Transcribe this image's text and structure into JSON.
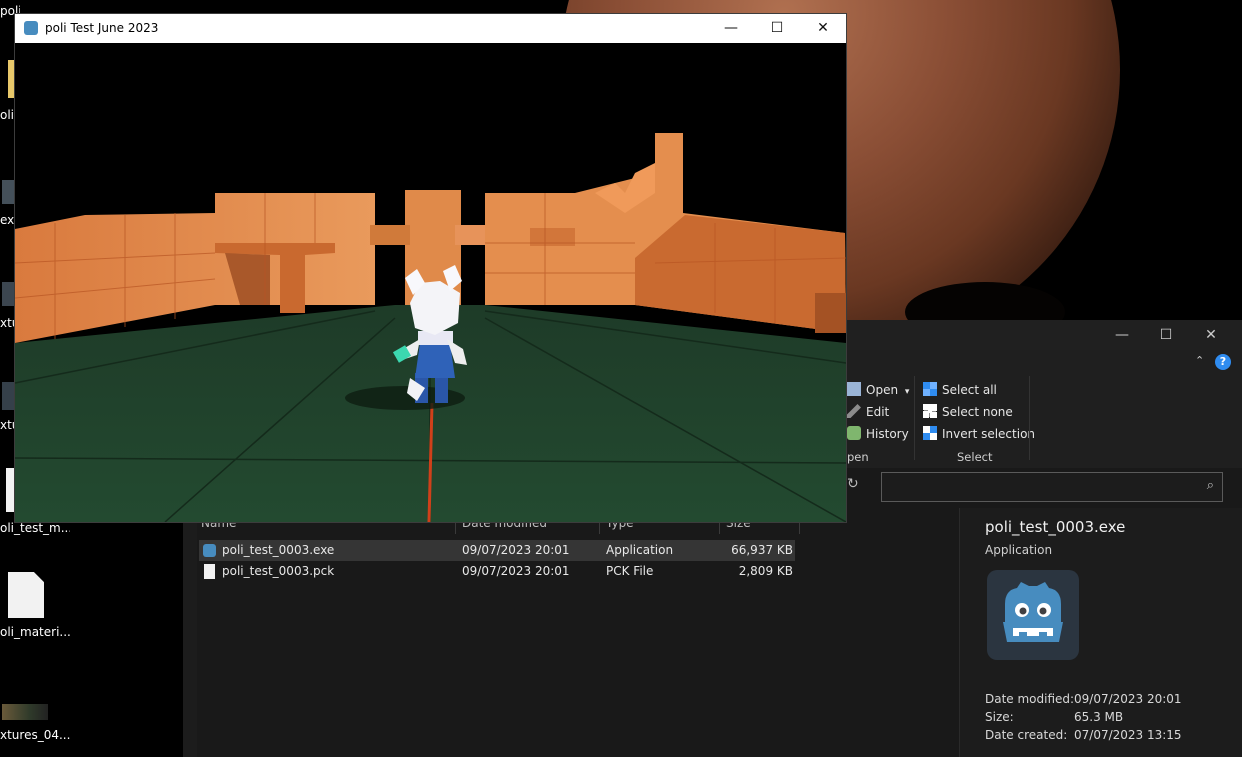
{
  "desktop": {
    "icons": [
      {
        "label": "poli_...",
        "icon": "folder-icon"
      },
      {
        "label": "oli",
        "icon": "folder-icon"
      },
      {
        "label": "ext",
        "icon": "image-icon"
      },
      {
        "label": "xtu",
        "icon": "image-icon"
      },
      {
        "label": "xtu",
        "icon": "image-icon"
      },
      {
        "label": "oli_test_m...",
        "icon": "file-icon"
      },
      {
        "label": "oli_materi...",
        "icon": "file-icon"
      },
      {
        "label": "xtures_04....",
        "icon": "image-icon"
      }
    ]
  },
  "game_window": {
    "title": "poli Test June 2023",
    "minimize": "—",
    "maximize": "☐",
    "close": "✕"
  },
  "explorer": {
    "minimize": "—",
    "maximize": "☐",
    "close": "✕",
    "ribbon": {
      "open_group": {
        "items": [
          {
            "label": "Open",
            "icon": "open-icon",
            "dropdown": "▾"
          },
          {
            "label": "Edit",
            "icon": "edit-icon"
          },
          {
            "label": "History",
            "icon": "history-icon"
          }
        ],
        "group_label": "pen"
      },
      "select_group": {
        "items": [
          {
            "label": "Select all",
            "icon": "select-all-icon"
          },
          {
            "label": "Select none",
            "icon": "select-none-icon"
          },
          {
            "label": "Invert selection",
            "icon": "invert-selection-icon"
          }
        ],
        "group_label": "Select"
      }
    },
    "search": {
      "placeholder": "",
      "value": ""
    },
    "columns": {
      "name": "Name",
      "date": "Date modified",
      "type": "Type",
      "size": "Size"
    },
    "files": [
      {
        "name": "poli_test_0003.exe",
        "date": "09/07/2023 20:01",
        "type": "Application",
        "size": "66,937 KB",
        "icon": "godot-app-icon",
        "selected": true
      },
      {
        "name": "poli_test_0003.pck",
        "date": "09/07/2023 20:01",
        "type": "PCK File",
        "size": "2,809 KB",
        "icon": "file-icon",
        "selected": false
      }
    ],
    "details": {
      "filename": "poli_test_0003.exe",
      "filetype": "Application",
      "icon": "godot-logo-icon",
      "fields": [
        {
          "label": "Date modified:",
          "value": "09/07/2023 20:01"
        },
        {
          "label": "Size:",
          "value": "65.3 MB"
        },
        {
          "label": "Date created:",
          "value": "07/07/2023 13:15"
        }
      ]
    }
  },
  "colors": {
    "accent": "#2f8cf0",
    "godot_blue": "#478cbf",
    "wall_orange": "#e0884a",
    "floor_green": "#264d32"
  }
}
